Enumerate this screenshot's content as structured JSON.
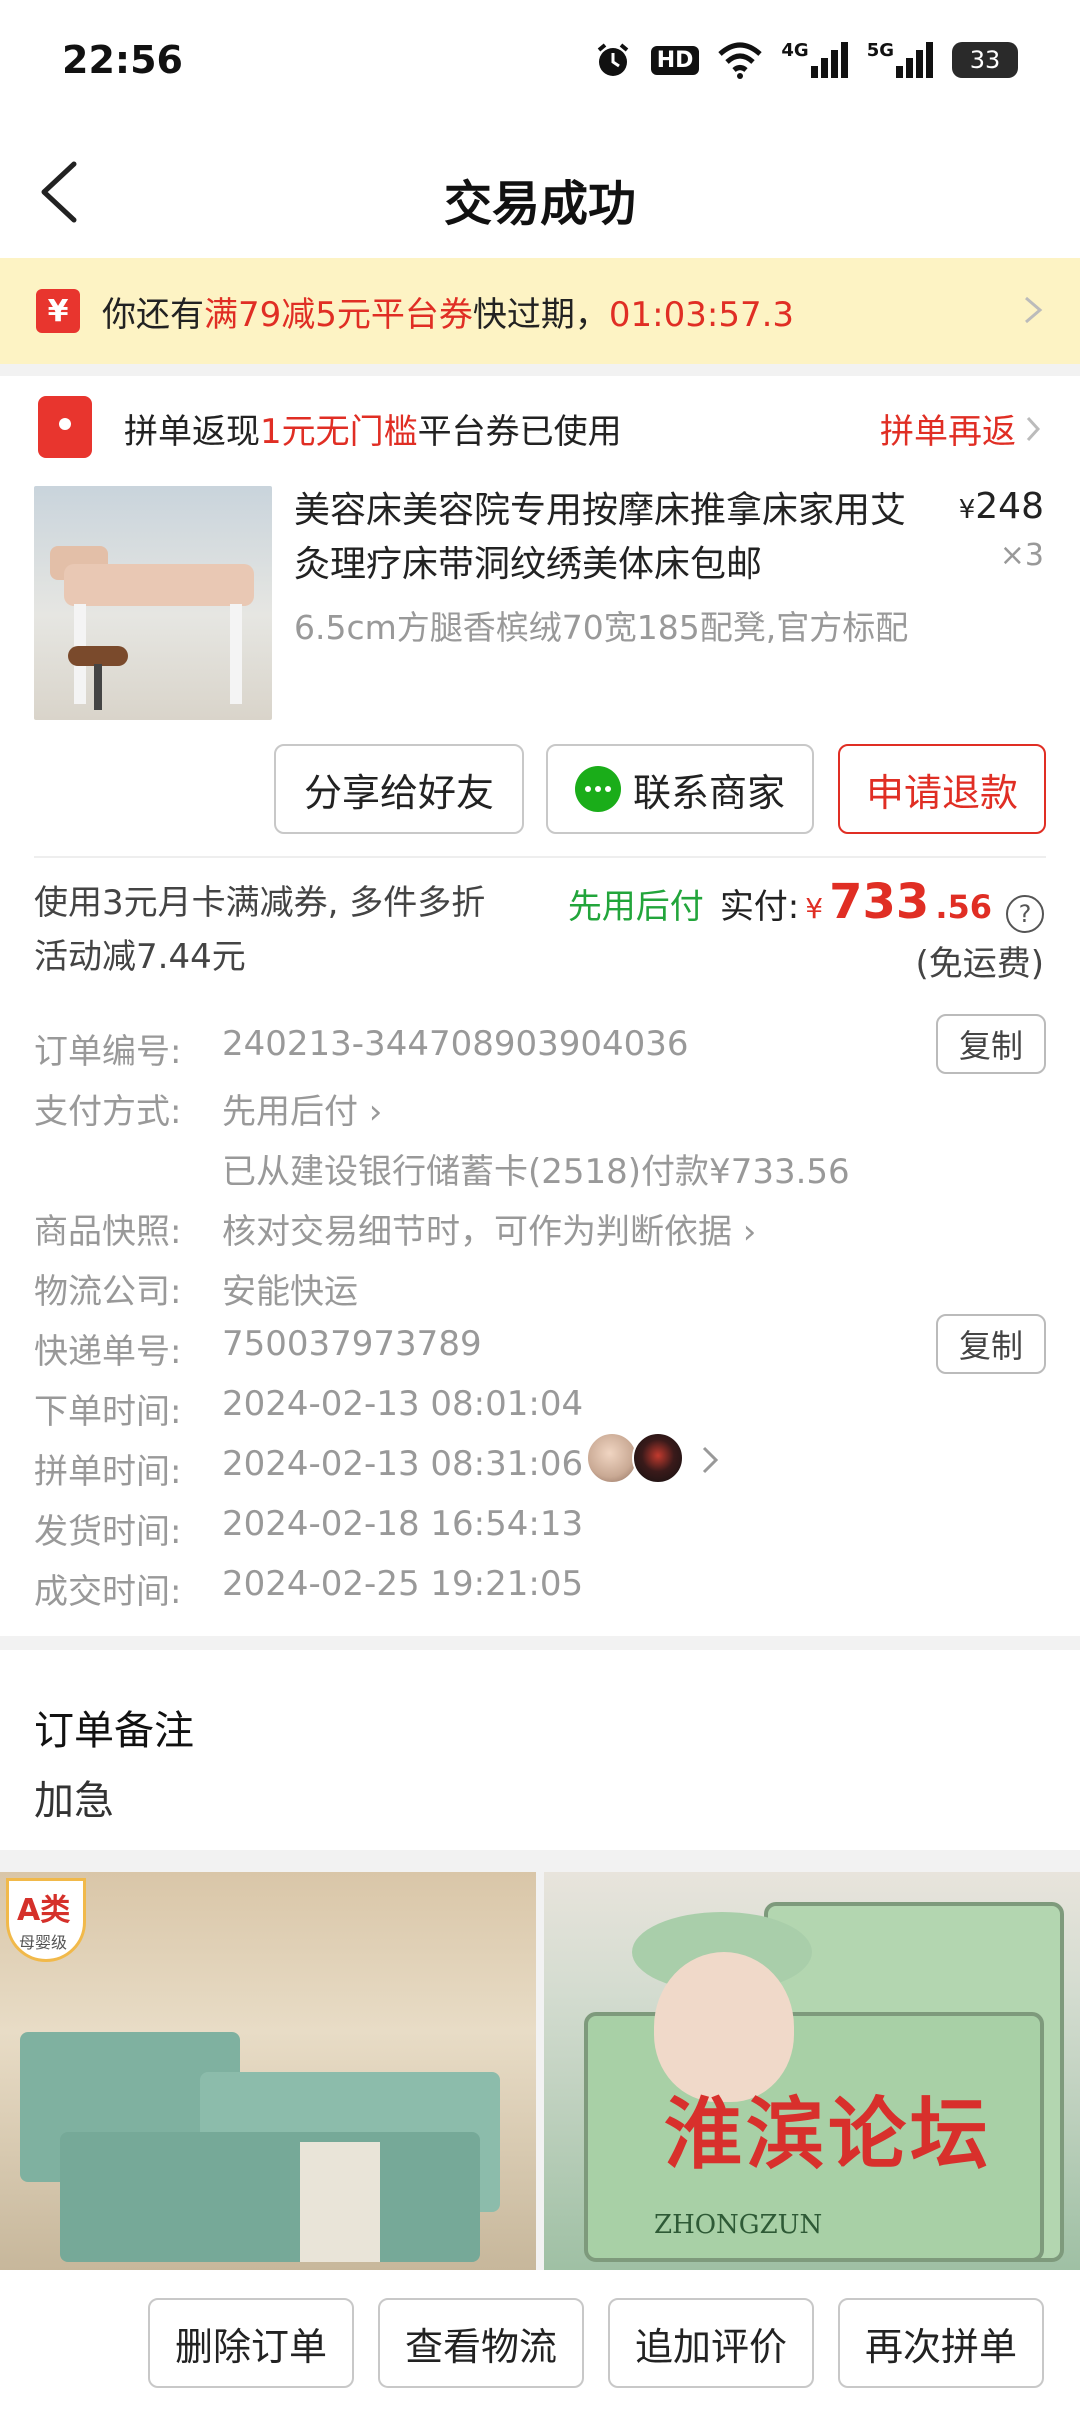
{
  "status_bar": {
    "time": "22:56",
    "icons": [
      "alarm-icon",
      "hd-icon",
      "wifi-icon",
      "4g-signal-icon",
      "5g-signal-icon",
      "battery-icon"
    ],
    "hd_label": "HD",
    "net_4g": "4G",
    "net_5g": "5G",
    "battery": "33"
  },
  "nav": {
    "title": "交易成功"
  },
  "coupon_banner": {
    "badge": "¥",
    "prefix": "你还有",
    "highlight": "满79减5元平台券",
    "suffix": "快过期，",
    "countdown": "01:03:57.3"
  },
  "order": {
    "rebate": {
      "prefix": "拼单返现",
      "highlight": "1元无门槛",
      "suffix": "平台券已使用",
      "link": "拼单再返"
    },
    "product": {
      "title": "美容床美容院专用按摩床推拿床家用艾灸理疗床带洞纹绣美体床包邮",
      "spec": "6.5cm方腿香槟绒70宽185配凳,官方标配",
      "price_symbol": "¥",
      "price": "248",
      "quantity": "×3"
    },
    "buttons": {
      "share": "分享给好友",
      "contact": "联系商家",
      "refund": "申请退款"
    },
    "discount_note": "使用3元月卡满减券, 多件多折活动减7.44元",
    "payment": {
      "pay_later": "先用后付",
      "paid_label": "实付:",
      "symbol": "¥",
      "amount_int": "733",
      "amount_dec": ".56",
      "help": "?",
      "freight": "(免运费)"
    }
  },
  "details": {
    "order_no_label": "订单编号:",
    "order_no": "240213-344708903904036",
    "copy": "复制",
    "pay_method_label": "支付方式:",
    "pay_method": "先用后付",
    "pay_source": "已从建设银行储蓄卡(2518)付款¥733.56",
    "snapshot_label": "商品快照:",
    "snapshot": "核对交易细节时，可作为判断依据",
    "logistics_label": "物流公司:",
    "logistics": "安能快运",
    "tracking_label": "快递单号:",
    "tracking": "750037973789",
    "order_time_label": "下单时间:",
    "order_time": "2024-02-13 08:01:04",
    "group_time_label": "拼单时间:",
    "group_time": "2024-02-13 08:31:06",
    "ship_time_label": "发货时间:",
    "ship_time": "2024-02-18 16:54:13",
    "done_time_label": "成交时间:",
    "done_time": "2024-02-25 19:21:05"
  },
  "notes": {
    "title": "订单备注",
    "text": "加急"
  },
  "recommend": {
    "badge_main": "A类",
    "badge_sub": "母婴级",
    "watermark": "淮滨论坛",
    "brand": "ZHONGZUN"
  },
  "bottom_bar": {
    "delete": "删除订单",
    "track": "查看物流",
    "review": "追加评价",
    "regroup": "再次拼单"
  },
  "colors": {
    "accent_red": "#e02e24",
    "pay_later_green": "#22a53b",
    "banner_yellow": "#fdf3c4"
  }
}
